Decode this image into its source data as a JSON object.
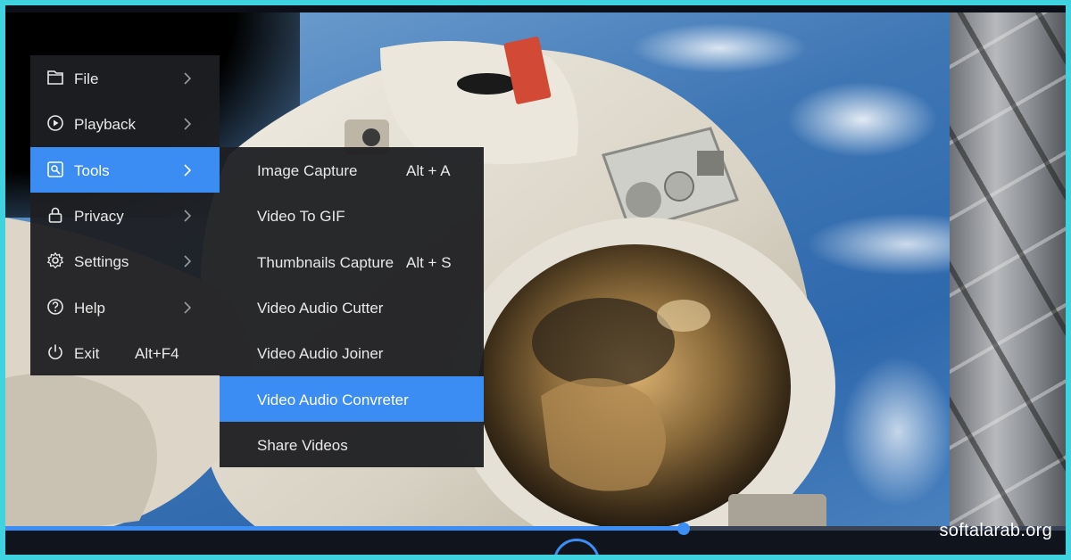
{
  "main_menu": {
    "items": [
      {
        "label": "File",
        "icon": "folder-icon",
        "has_submenu": true
      },
      {
        "label": "Playback",
        "icon": "play-circle-icon",
        "has_submenu": true
      },
      {
        "label": "Tools",
        "icon": "screen-capture-icon",
        "has_submenu": true,
        "active": true
      },
      {
        "label": "Privacy",
        "icon": "lock-icon",
        "has_submenu": true
      },
      {
        "label": "Settings",
        "icon": "gear-icon",
        "has_submenu": true
      },
      {
        "label": "Help",
        "icon": "question-circle-icon",
        "has_submenu": true
      },
      {
        "label": "Exit",
        "icon": "power-icon",
        "shortcut": "Alt+F4"
      }
    ]
  },
  "tools_submenu": {
    "items": [
      {
        "label": "Image Capture",
        "shortcut": "Alt + A"
      },
      {
        "label": "Video To GIF"
      },
      {
        "label": "Thumbnails Capture",
        "shortcut": "Alt + S"
      },
      {
        "label": "Video Audio Cutter"
      },
      {
        "label": "Video Audio Joiner"
      },
      {
        "label": "Video Audio Convreter",
        "active": true
      },
      {
        "label": "Share Videos"
      }
    ]
  },
  "player": {
    "progress": 0.64
  },
  "watermark": "softalarab.org",
  "colors": {
    "accent": "#3b8cf3",
    "menu_bg": "#1e1f22",
    "frame": "#3ed3de"
  }
}
